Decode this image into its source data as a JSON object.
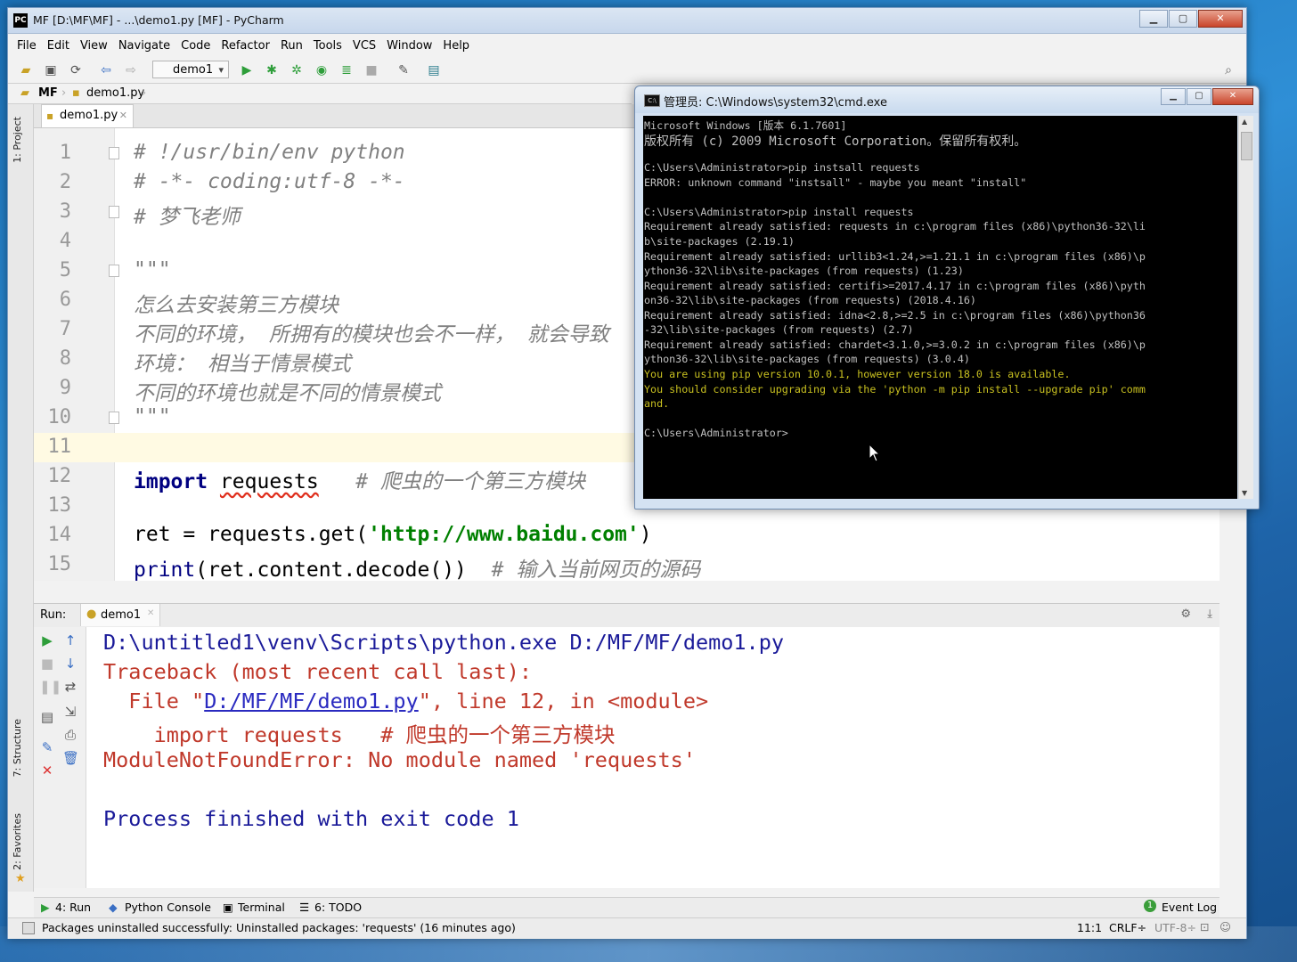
{
  "pycharm": {
    "title": "MF [D:\\MF\\MF] - ...\\demo1.py [MF] - PyCharm",
    "app_icon_text": "PC",
    "menu": [
      "File",
      "Edit",
      "View",
      "Navigate",
      "Code",
      "Refactor",
      "Run",
      "Tools",
      "VCS",
      "Window",
      "Help"
    ],
    "run_config": "demo1",
    "breadcrumb": [
      "MF",
      "demo1.py"
    ],
    "editor_tab": "demo1.py",
    "left_tabs": {
      "project": "1: Project",
      "structure": "7: Structure",
      "favorites": "2: Favorites"
    },
    "code_lines": [
      {
        "n": "1",
        "text": "# !/usr/bin/env python"
      },
      {
        "n": "2",
        "text": "# -*- coding:utf-8 -*-"
      },
      {
        "n": "3",
        "text": "# 梦飞老师"
      },
      {
        "n": "4",
        "text": ""
      },
      {
        "n": "5",
        "text": "\"\"\""
      },
      {
        "n": "6",
        "text": "怎么去安装第三方模块"
      },
      {
        "n": "7",
        "text": "不同的环境， 所拥有的模块也会不一样， 就会导致"
      },
      {
        "n": "8",
        "text": "环境： 相当于情景模式"
      },
      {
        "n": "9",
        "text": "不同的环境也就是不同的情景模式"
      },
      {
        "n": "10",
        "text": "\"\"\""
      },
      {
        "n": "11",
        "text": ""
      },
      {
        "n": "12",
        "kw": "import",
        "mod": "requests",
        "comment": "# 爬虫的一个第三方模块"
      },
      {
        "n": "13",
        "text": ""
      },
      {
        "n": "14",
        "pre": "ret = requests.get(",
        "str": "'http://www.baidu.com'",
        "post": ")"
      },
      {
        "n": "15",
        "fn": "print",
        "mid": "(ret.content.decode())",
        "comment": "# 输入当前网页的源码"
      }
    ],
    "run": {
      "label": "Run:",
      "tab": "demo1",
      "output": {
        "cmd": "D:\\untitled1\\venv\\Scripts\\python.exe D:/MF/MF/demo1.py",
        "traceback": "Traceback (most recent call last):",
        "file_pre": "  File \"",
        "file_link": "D:/MF/MF/demo1.py",
        "file_post": "\", line 12, in <module>",
        "import_line": "    import requests   # 爬虫的一个第三方模块",
        "error": "ModuleNotFoundError: No module named 'requests'",
        "finished": "Process finished with exit code 1"
      }
    },
    "bottom_tabs": {
      "run": "4: Run",
      "console": "Python Console",
      "terminal": "Terminal",
      "todo": "6: TODO",
      "event_log": "Event Log",
      "event_count": "1"
    },
    "status": {
      "message": "Packages uninstalled successfully: Uninstalled packages: 'requests' (16 minutes ago)",
      "position": "11:1",
      "line_sep": "CRLF÷",
      "encoding": "UTF-8÷"
    }
  },
  "cmd": {
    "title": "管理员: C:\\Windows\\system32\\cmd.exe",
    "icon_text": "C:\\",
    "lines": [
      {
        "t": "Microsoft Windows [版本 6.1.7601]"
      },
      {
        "t": "版权所有 (c) 2009 Microsoft Corporation。保留所有权利。"
      },
      {
        "t": ""
      },
      {
        "t": "C:\\Users\\Administrator>pip instsall requests"
      },
      {
        "t": "ERROR: unknown command \"instsall\" - maybe you meant \"install\""
      },
      {
        "t": ""
      },
      {
        "t": "C:\\Users\\Administrator>pip install requests"
      },
      {
        "t": "Requirement already satisfied: requests in c:\\program files (x86)\\python36-32\\li"
      },
      {
        "t": "b\\site-packages (2.19.1)"
      },
      {
        "t": "Requirement already satisfied: urllib3<1.24,>=1.21.1 in c:\\program files (x86)\\p"
      },
      {
        "t": "ython36-32\\lib\\site-packages (from requests) (1.23)"
      },
      {
        "t": "Requirement already satisfied: certifi>=2017.4.17 in c:\\program files (x86)\\pyth"
      },
      {
        "t": "on36-32\\lib\\site-packages (from requests) (2018.4.16)"
      },
      {
        "t": "Requirement already satisfied: idna<2.8,>=2.5 in c:\\program files (x86)\\python36"
      },
      {
        "t": "-32\\lib\\site-packages (from requests) (2.7)"
      },
      {
        "t": "Requirement already satisfied: chardet<3.1.0,>=3.0.2 in c:\\program files (x86)\\p"
      },
      {
        "t": "ython36-32\\lib\\site-packages (from requests) (3.0.4)"
      },
      {
        "t": "You are using pip version 10.0.1, however version 18.0 is available.",
        "c": "yellow"
      },
      {
        "t": "You should consider upgrading via the 'python -m pip install --upgrade pip' comm",
        "c": "yellow"
      },
      {
        "t": "and.",
        "c": "yellow"
      },
      {
        "t": ""
      },
      {
        "t": "C:\\Users\\Administrator>"
      }
    ]
  }
}
